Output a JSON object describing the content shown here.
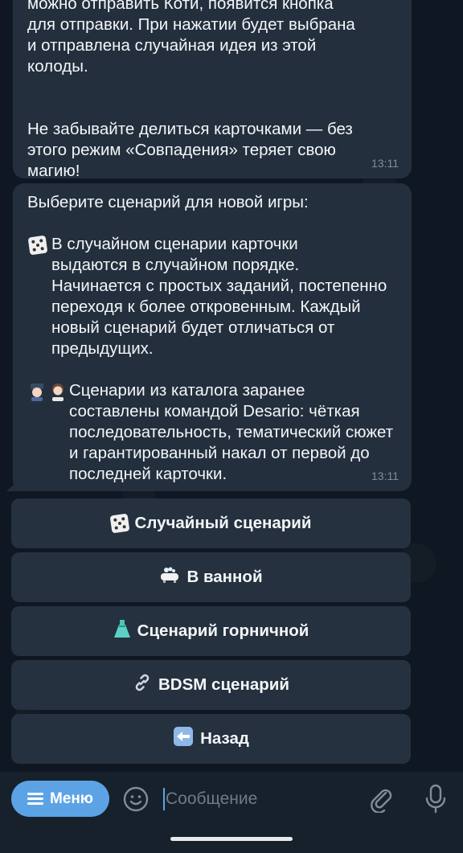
{
  "messages": [
    {
      "paragraphs": [
        "можно отправить Коти, появится кнопка\nдля отправки. При нажатии будет выбрана\nи отправлена случайная идея из этой\nколоды.",
        "Не забывайте делиться карточками — без\nэтого режим «Совпадения» теряет свою\nмагию!"
      ],
      "time": "13:11"
    },
    {
      "intro": "Выберите сценарий для новой игры:",
      "random_paragraph": "В случайном сценарии карточки\nвыдаются в случайном порядке.\nНачинается с простых заданий, постепенно\nпереходя к более откровенным. Каждый\nновый сценарий будет отличаться от\nпредыдущих.",
      "catalog_paragraph": "Сценарии из каталога заранее\nсоставлены командой Desario: чёткая\nпоследовательность, тематический сюжет\nи гарантированный накал от первой до\nпоследней карточки.",
      "time": "13:11"
    }
  ],
  "keyboard": {
    "buttons": [
      {
        "label": "Случайный сценарий",
        "icon": "dice-icon"
      },
      {
        "label": "В ванной",
        "icon": "bathtub-icon"
      },
      {
        "label": "Сценарий горничной",
        "icon": "dress-icon"
      },
      {
        "label": "BDSM сценарий",
        "icon": "link-chain-icon"
      },
      {
        "label": "Назад",
        "icon": "back-arrow-icon"
      }
    ]
  },
  "composer": {
    "menu_label": "Меню",
    "placeholder": "Сообщение"
  },
  "colors": {
    "background": "#0f1722",
    "bubble": "#232f3d",
    "accent": "#5ca3e6",
    "timestamp": "#7f8c99"
  }
}
